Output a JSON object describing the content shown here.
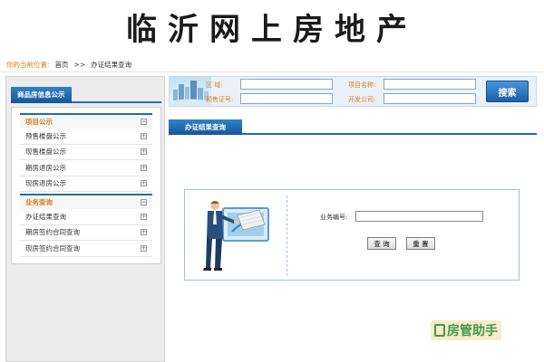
{
  "banner": {
    "title": "临沂网上房地产"
  },
  "breadcrumb": {
    "lead": "你的当前位置:",
    "home": "首页",
    "sep": ">>",
    "current": "办证结果查询"
  },
  "sidebar": {
    "panel_title": "商品房信息公示",
    "groups": [
      {
        "title": "项目公示",
        "items": [
          "预售楼盘公示",
          "现售楼盘公示",
          "期房退房公示",
          "现房退房公示"
        ]
      },
      {
        "title": "业务查询",
        "items": [
          "办证结果查询",
          "期房签约合同查询",
          "现房签约合同查询"
        ]
      }
    ]
  },
  "search": {
    "district_label": "区      域:",
    "permit_label": "预售证号:",
    "project_label": "项目名称:",
    "developer_label": "开发公司:",
    "button_label": "搜索",
    "values": {
      "district": "",
      "permit": "",
      "project": "",
      "developer": ""
    }
  },
  "result": {
    "tab_label": "办证结果查询",
    "business_no_label": "业务编号:",
    "business_no_value": "",
    "query_button": "查 询",
    "reset_button": "重 置"
  },
  "watermark": {
    "text": "房管助手"
  },
  "colors": {
    "accent_blue": "#1a6fb4",
    "label_orange": "#e07d1a",
    "panel_bg": "#ececec",
    "watermark_green": "#3c9a52"
  }
}
